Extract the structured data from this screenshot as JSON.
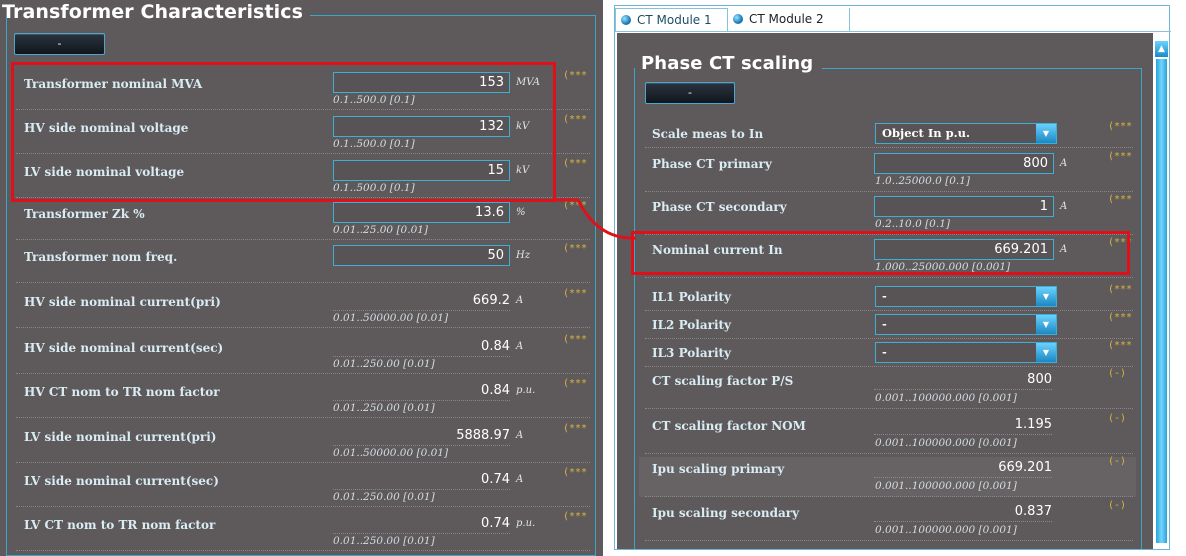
{
  "left": {
    "title": "Transformer Characteristics",
    "collapse_label": "-",
    "rows": [
      {
        "label": "Transformer nominal MVA",
        "value": "153",
        "unit": "MVA",
        "range": "0.1..500.0 [0.1]",
        "stars": "(***",
        "editable": true
      },
      {
        "label": "HV side nominal voltage",
        "value": "132",
        "unit": "kV",
        "range": "0.1..500.0 [0.1]",
        "stars": "(***",
        "editable": true
      },
      {
        "label": "LV side nominal voltage",
        "value": "15",
        "unit": "kV",
        "range": "0.1..500.0 [0.1]",
        "stars": "(***",
        "editable": true
      },
      {
        "label": "Transformer Zk %",
        "value": "13.6",
        "unit": "%",
        "range": "0.01..25.00 [0.01]",
        "stars": "(***",
        "editable": true
      },
      {
        "label": "Transformer nom freq.",
        "value": "50",
        "unit": "Hz",
        "range": "",
        "stars": "(***",
        "editable": true
      },
      {
        "label": "HV side nominal current(pri)",
        "value": "669.2",
        "unit": "A",
        "range": "0.01..50000.00 [0.01]",
        "stars": "(***",
        "editable": false
      },
      {
        "label": "HV side nominal current(sec)",
        "value": "0.84",
        "unit": "A",
        "range": "0.01..250.00 [0.01]",
        "stars": "(***",
        "editable": false
      },
      {
        "label": "HV CT nom to TR nom factor",
        "value": "0.84",
        "unit": "p.u.",
        "range": "0.01..250.00 [0.01]",
        "stars": "(***",
        "editable": false
      },
      {
        "label": "LV side nominal current(pri)",
        "value": "5888.97",
        "unit": "A",
        "range": "0.01..50000.00 [0.01]",
        "stars": "(***",
        "editable": false
      },
      {
        "label": "LV side nominal current(sec)",
        "value": "0.74",
        "unit": "A",
        "range": "0.01..250.00 [0.01]",
        "stars": "(***",
        "editable": false
      },
      {
        "label": "LV CT nom to TR nom factor",
        "value": "0.74",
        "unit": "p.u.",
        "range": "0.01..250.00 [0.01]",
        "stars": "(***",
        "editable": false
      }
    ]
  },
  "right": {
    "tabs": [
      {
        "label": "CT Module 1",
        "active": true
      },
      {
        "label": "CT Module 2",
        "active": false
      }
    ],
    "title": "Phase CT scaling",
    "collapse_label": "-",
    "rows": [
      {
        "label": "Scale meas to In",
        "kind": "dropdown",
        "value": "Object In p.u.",
        "stars": "(***"
      },
      {
        "label": "Phase CT primary",
        "kind": "field",
        "value": "800",
        "unit": "A",
        "range": "1.0..25000.0 [0.1]",
        "stars": "(***"
      },
      {
        "label": "Phase CT secondary",
        "kind": "field",
        "value": "1",
        "unit": "A",
        "range": "0.2..10.0 [0.1]",
        "stars": "(***"
      },
      {
        "label": "Nominal current In",
        "kind": "field",
        "value": "669.201",
        "unit": "A",
        "range": "1.000..25000.000 [0.001]",
        "stars": "(***"
      },
      {
        "label": "IL1 Polarity",
        "kind": "dropdown",
        "value": "-",
        "stars": "(***"
      },
      {
        "label": "IL2 Polarity",
        "kind": "dropdown",
        "value": "-",
        "stars": "(***"
      },
      {
        "label": "IL3 Polarity",
        "kind": "dropdown",
        "value": "-",
        "stars": "(***"
      },
      {
        "label": "CT scaling factor P/S",
        "kind": "readonly",
        "value": "800",
        "range": "0.001..100000.000 [0.001]",
        "stars": "(-)"
      },
      {
        "label": "CT scaling factor NOM",
        "kind": "readonly",
        "value": "1.195",
        "range": "0.001..100000.000 [0.001]",
        "stars": "(-)"
      },
      {
        "label": "Ipu scaling primary",
        "kind": "readonly",
        "value": "669.201",
        "range": "0.001..100000.000 [0.001]",
        "stars": "(-)"
      },
      {
        "label": "Ipu scaling secondary",
        "kind": "readonly",
        "value": "0.837",
        "range": "0.001..100000.000 [0.001]",
        "stars": "(-)"
      }
    ]
  },
  "colors": {
    "panel_bg": "#5e5a5c",
    "accent_blue": "#3faed6",
    "highlight_red": "#e0101a",
    "stars_gold": "#d8b43c"
  },
  "icons": {
    "tab_indicator": "blue-orb-icon",
    "dropdown_arrow": "chevron-down-icon",
    "scroll_up": "scroll-up-arrow-icon"
  }
}
